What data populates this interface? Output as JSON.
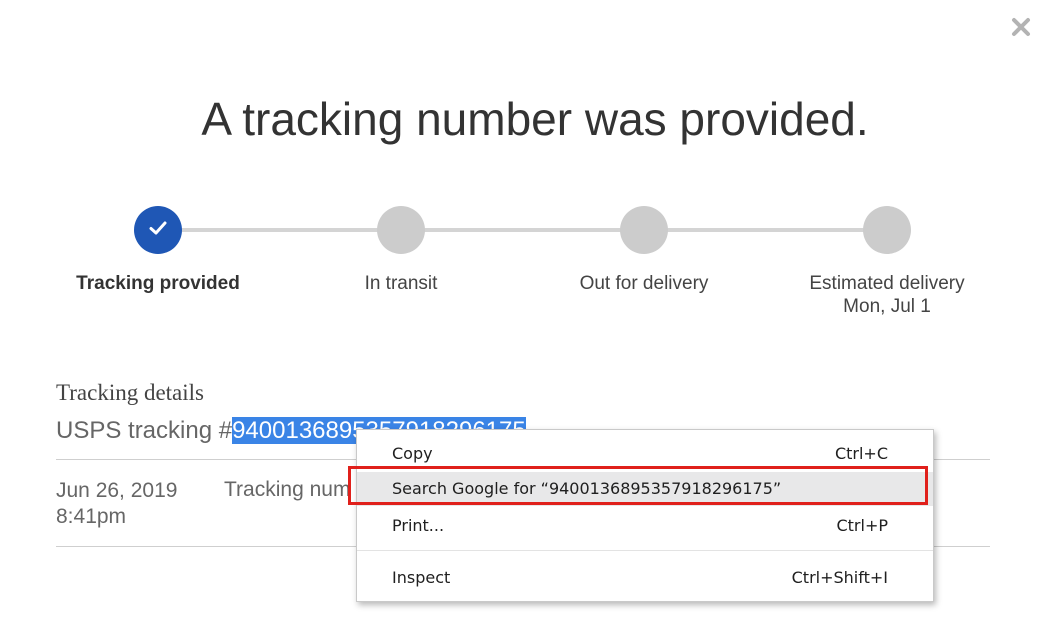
{
  "dialog": {
    "title": "A tracking number was provided.",
    "close_icon": "close-icon"
  },
  "progress": {
    "steps": [
      {
        "label": "Tracking provided",
        "status": "complete"
      },
      {
        "label": "In transit",
        "status": "pending"
      },
      {
        "label": "Out for delivery",
        "status": "pending"
      },
      {
        "label": "Estimated delivery",
        "sublabel": "Mon, Jul 1",
        "status": "pending"
      }
    ]
  },
  "details": {
    "heading": "Tracking details",
    "carrier_prefix": "USPS tracking #",
    "tracking_number": "9400136895357918296175"
  },
  "events": [
    {
      "date": "Jun 26, 2019",
      "time": "8:41pm",
      "description": "Tracking num"
    }
  ],
  "context_menu": {
    "items": [
      {
        "label": "Copy",
        "shortcut": "Ctrl+C"
      },
      {
        "label": "Search Google for “9400136895357918296175”",
        "shortcut": ""
      },
      {
        "label": "Print...",
        "shortcut": "Ctrl+P"
      },
      {
        "label": "Inspect",
        "shortcut": "Ctrl+Shift+I"
      }
    ]
  },
  "colors": {
    "accent": "#1f57b5",
    "selection": "#3a84e6",
    "highlight_border": "#e0201b",
    "pending_step": "#cccccc"
  }
}
